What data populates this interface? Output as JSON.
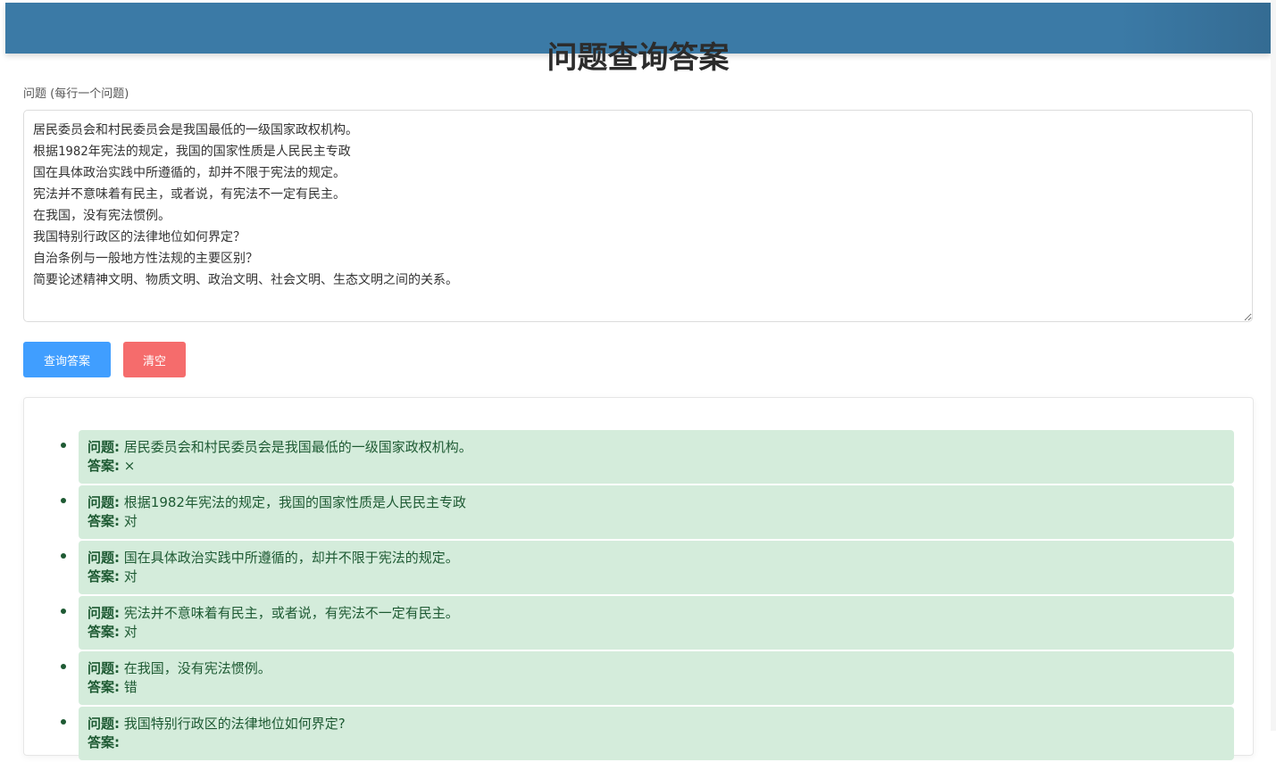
{
  "header": {
    "title": "问题查询答案"
  },
  "form": {
    "label": "问题 (每行一个问题)",
    "questions_text": "居民委员会和村民委员会是我国最低的一级国家政权机构。\n根据1982年宪法的规定，我国的国家性质是人民民主专政\n国在具体政治实践中所遵循的，却并不限于宪法的规定。\n宪法并不意味着有民主，或者说，有宪法不一定有民主。\n在我国，没有宪法惯例。\n我国特别行政区的法律地位如何界定？\n自治条例与一般地方性法规的主要区别？\n简要论述精神文明、物质文明、政治文明、社会文明、生态文明之间的关系。",
    "query_button": "查询答案",
    "clear_button": "清空"
  },
  "results": {
    "question_label": "问题:",
    "answer_label": "答案:",
    "items": [
      {
        "question": "居民委员会和村民委员会是我国最低的一级国家政权机构。",
        "answer": "×"
      },
      {
        "question": "根据1982年宪法的规定，我国的国家性质是人民民主专政",
        "answer": "对"
      },
      {
        "question": "国在具体政治实践中所遵循的，却并不限于宪法的规定。",
        "answer": "对"
      },
      {
        "question": "宪法并不意味着有民主，或者说，有宪法不一定有民主。",
        "answer": "对"
      },
      {
        "question": "在我国，没有宪法惯例。",
        "answer": "错"
      },
      {
        "question": "我国特别行政区的法律地位如何界定?",
        "answer": ""
      }
    ]
  },
  "colors": {
    "header_bar": "#3b7aa6",
    "query_button": "#409eff",
    "clear_button": "#f56c6c",
    "result_bg": "#d4ecdb",
    "result_text": "#1e5a33"
  }
}
